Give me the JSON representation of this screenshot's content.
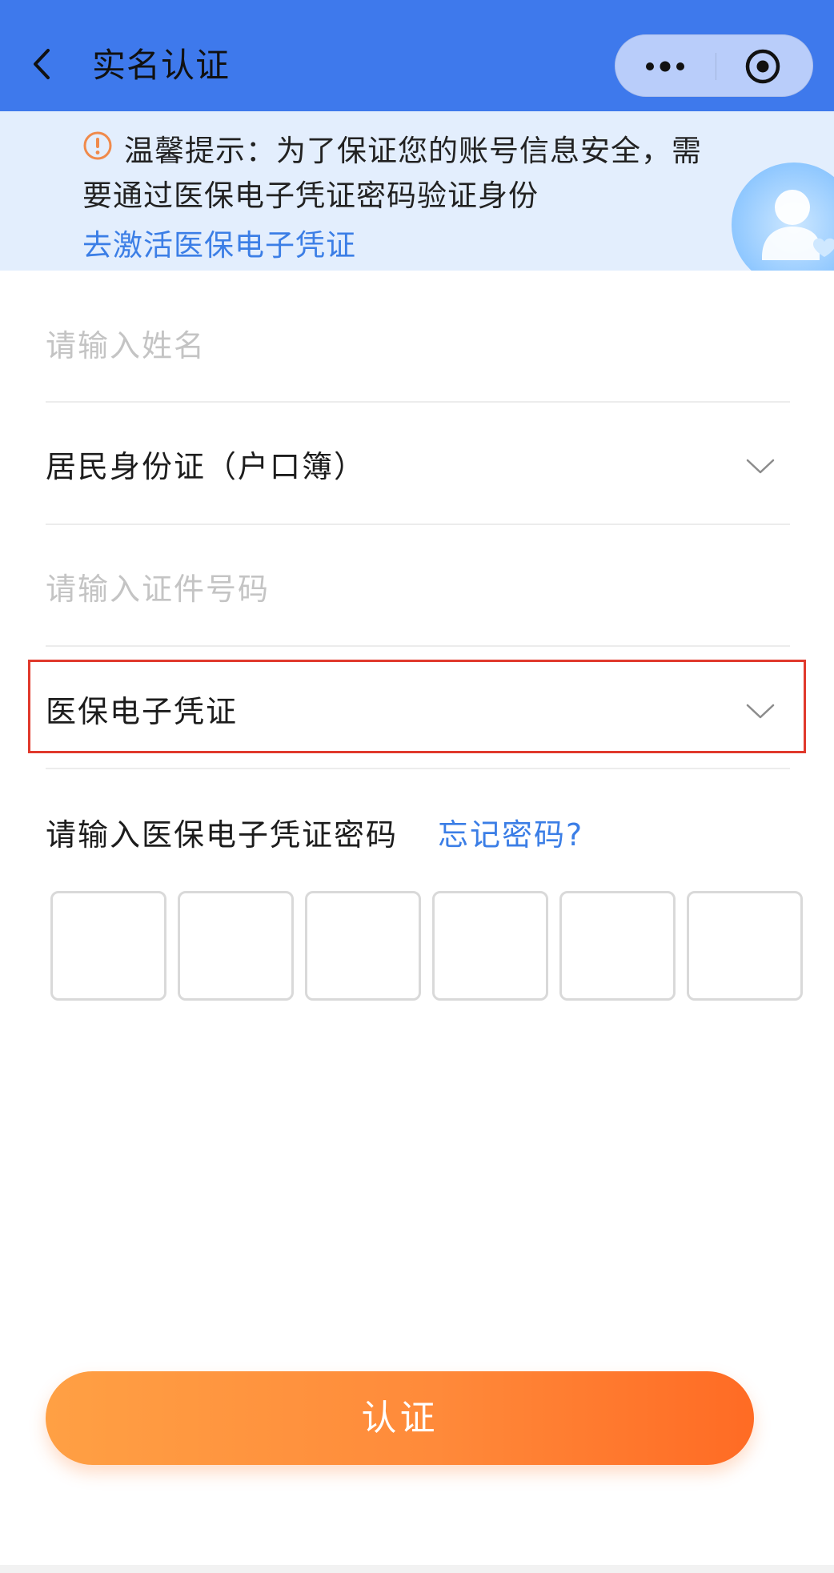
{
  "header": {
    "title": "实名认证",
    "back_icon": "chevron-left-icon",
    "menu_icon": "more-dots-icon",
    "close_icon": "target-circle-icon",
    "bg_color": "#3e79ec"
  },
  "notice": {
    "icon": "warning-circle-icon",
    "text": "温馨提示：为了保证您的账号信息安全，需要通过医保电子凭证密码验证身份",
    "link_label": "去激活医保电子凭证",
    "bg_color": "#e3eefd",
    "illustration": "user-heart-illustration"
  },
  "form": {
    "name_placeholder": "请输入姓名",
    "id_type_value": "居民身份证（户口簿）",
    "id_number_placeholder": "请输入证件号码",
    "credential_type_value": "医保电子凭证",
    "password_label": "请输入医保电子凭证密码",
    "forgot_password_label": "忘记密码?",
    "pin_length": 6
  },
  "submit": {
    "label": "认证",
    "gradient_start": "#ffa044",
    "gradient_end": "#ff6b24"
  },
  "colors": {
    "link": "#3b7ee6",
    "highlight_border": "#e0392c"
  }
}
